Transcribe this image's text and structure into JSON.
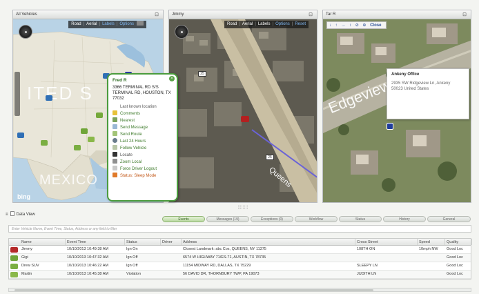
{
  "panes": [
    {
      "title": "All Vehicles",
      "pin": "⊡"
    },
    {
      "title": "Jimmy",
      "pin": "⊡"
    },
    {
      "title": "Tar R",
      "pin": "⊡"
    }
  ],
  "map1": {
    "toolbar": {
      "road": "Road",
      "aerial": "Aerial",
      "labels": "Labels",
      "options": "Options"
    },
    "country": "ITED S",
    "country2": "MEXICO",
    "logo": "bing"
  },
  "map2": {
    "toolbar": {
      "road": "Road",
      "aerial": "Aerial",
      "labels": "Labels",
      "options": "Options",
      "reset": "Reset"
    },
    "street": "Queens",
    "shield1": "25",
    "shield2": "25"
  },
  "map3": {
    "tools": {
      "a": "↓",
      "b": "↑",
      "c": "→",
      "d": "↕",
      "e": "⊘",
      "f": "⊕",
      "close": "Close"
    },
    "street": "Edgeview ln"
  },
  "callout": {
    "title": "Fred R",
    "address": "3366 TERMINAL RD S/S TERMINAL RD, HOUSTON, TX 77032",
    "actions": [
      "Last known location",
      "Comments",
      "Nearest",
      "Send Message",
      "Send Route",
      "Last 24 Hours",
      "Follow Vehicle",
      "Locate",
      "Zoom Local",
      "Force Driver Logout",
      "Status: Sleep Mode"
    ]
  },
  "tooltip": {
    "title": "Ankeny Office",
    "line1": "2935 SW Ridgeview Ln, Ankeny",
    "line2": "50023 United States"
  },
  "dataview": {
    "title": "Data View",
    "tabs": [
      "Events",
      "Messages (19)",
      "Exceptions (0)",
      "Workflow",
      "Status",
      "History",
      "General"
    ],
    "filter_placeholder": "Enter Vehicle Name, Event Time, Status, Address or any field to filter",
    "columns": [
      "Name",
      "Event Time",
      "Status",
      "Driver",
      "Address",
      "Cross Street",
      "Speed",
      "Quality"
    ],
    "rows": [
      {
        "name": "Jimmy",
        "time": "10/10/2013 10:49:38 AM",
        "status": "Ign On",
        "driver": "",
        "address": "Closest Landmark: abc Cos, QUEENS, NY 11375",
        "cross": "108TH ON",
        "speed": "10mph NW",
        "quality": "Good Loc"
      },
      {
        "name": "Gigi",
        "time": "10/10/2013 10:47:32 AM",
        "status": "Ign Off",
        "driver": "",
        "address": "6574 W HIGHWAY 71/ES-71, AUSTIN, TX 78735",
        "cross": "",
        "speed": "",
        "quality": "Good Loc"
      },
      {
        "name": "Drew SUV",
        "time": "10/10/2013 10:46:22 AM",
        "status": "Ign Off",
        "driver": "",
        "address": "11154 MIDWAY RD, DALLAS, TX 75229",
        "cross": "SLEEPY LN",
        "speed": "",
        "quality": "Good Loc"
      },
      {
        "name": "Martin",
        "time": "10/10/2013 10:45:38 AM",
        "status": "Violation",
        "driver": "",
        "address": "56 DAVID DR, THORNBURY TWP, PA 19073",
        "cross": "JUDITH LN",
        "speed": "",
        "quality": "Good Loc"
      }
    ]
  },
  "colors": {
    "accent": "#4a9c3c",
    "link": "#2a4f99"
  }
}
